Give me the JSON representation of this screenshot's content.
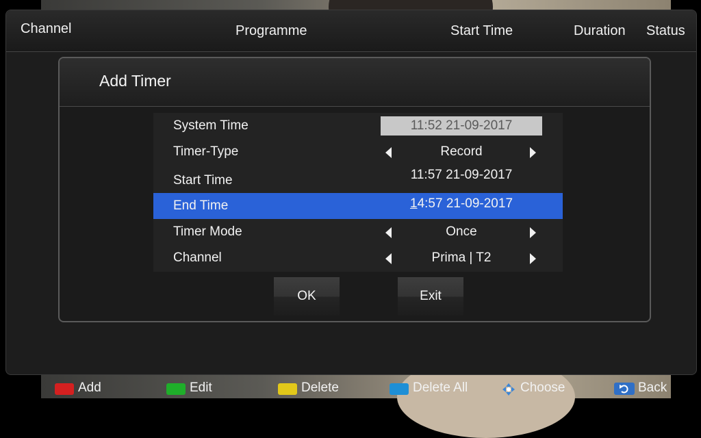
{
  "header": {
    "columns": [
      "Channel",
      "Programme",
      "Start Time",
      "Duration",
      "Status"
    ]
  },
  "dialog": {
    "title": "Add Timer",
    "rows": [
      {
        "label": "System Time",
        "value": "11:52  21-09-2017",
        "arrows": false
      },
      {
        "label": "Timer-Type",
        "value": "Record",
        "arrows": true
      },
      {
        "label": "Start Time",
        "value": "11:57  21-09-2017",
        "arrows": false
      },
      {
        "label": "End Time",
        "value_cursor": "1",
        "value_rest": "4:57  21-09-2017",
        "arrows": false,
        "selected": true
      },
      {
        "label": "Timer Mode",
        "value": "Once",
        "arrows": true
      },
      {
        "label": "Channel",
        "value": "Prima | T2",
        "arrows": true
      }
    ],
    "ok_label": "OK",
    "exit_label": "Exit"
  },
  "footer": {
    "items": [
      {
        "label": "Add",
        "key_color": "#d42020"
      },
      {
        "label": "Edit",
        "key_color": "#1fae2a"
      },
      {
        "label": "Delete",
        "key_color": "#e2c81a"
      },
      {
        "label": "Delete All",
        "key_color": "#1e8fd6"
      },
      {
        "label": "Choose",
        "icon": "choose-arrows-icon"
      },
      {
        "label": "Back",
        "icon": "back-icon"
      }
    ]
  },
  "colors": {
    "selection": "#2a62d8",
    "panel": "#1d1d1d"
  }
}
